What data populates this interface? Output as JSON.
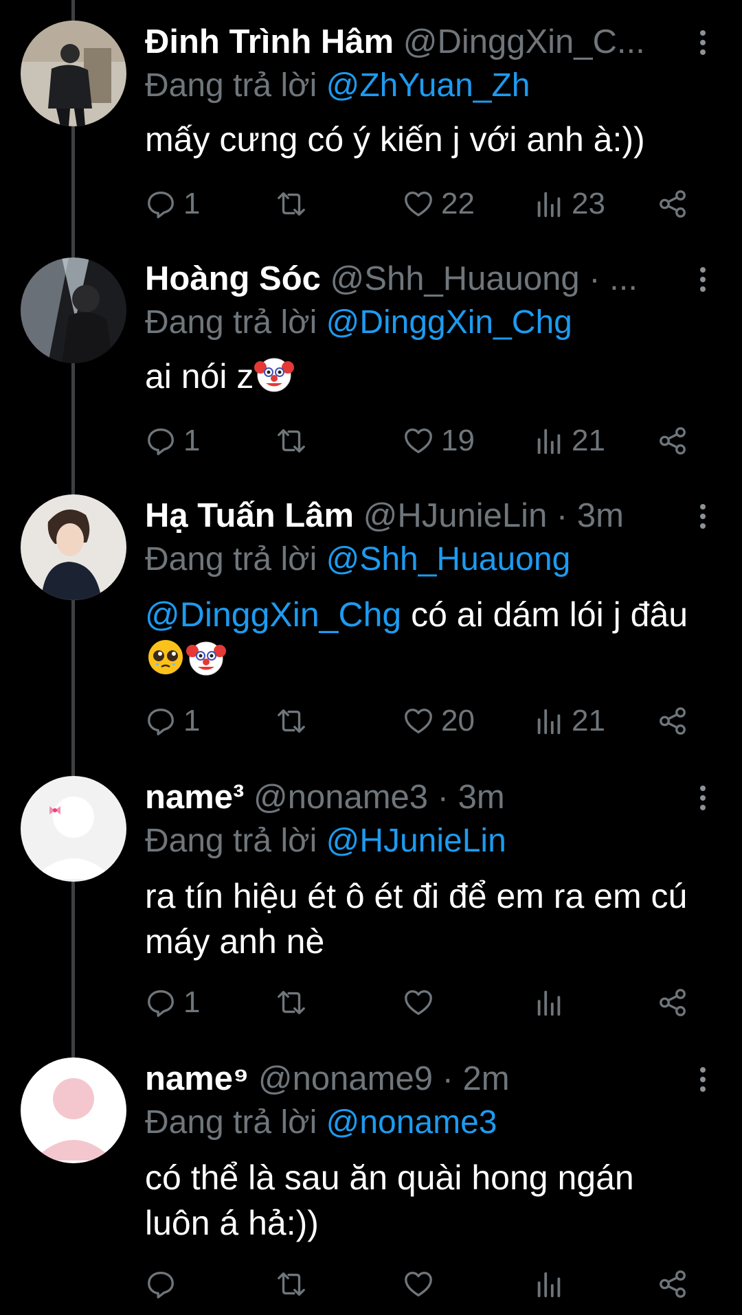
{
  "reply_prefix": "Đang trả lời",
  "icons": {
    "more": "more-vertical-icon",
    "reply": "comment-icon",
    "retweet": "retweet-icon",
    "like": "heart-icon",
    "views": "views-bar-icon",
    "share": "share-icon"
  },
  "colors": {
    "background": "#000000",
    "mention": "#1d9bf0",
    "muted": "#6f767b",
    "thread_line": "#3e4144"
  },
  "tweets": [
    {
      "display_name": "Đinh Trình Hâm",
      "handle_meta": "@DinggXin_C...",
      "reply_to": "@ZhYuan_Zh",
      "body_lead_mention": "",
      "body": "mấy cưng có ý kiến j với anh à:))",
      "emojis": [],
      "replies": "1",
      "retweets": "",
      "likes": "22",
      "views": "23"
    },
    {
      "display_name": "Hoàng Sóc",
      "handle_meta": "@Shh_Huauong · ...",
      "reply_to": "@DinggXin_Chg",
      "body_lead_mention": "",
      "body": "ai nói z",
      "emojis": [
        "clown-face"
      ],
      "replies": "1",
      "retweets": "",
      "likes": "19",
      "views": "21"
    },
    {
      "display_name": "Hạ Tuấn Lâm",
      "handle_meta": "@HJunieLin · 3m",
      "reply_to": "@Shh_Huauong",
      "body_lead_mention": "@DinggXin_Chg",
      "body": " có ai dám lói j đâu",
      "emojis": [
        "pleading-face",
        "clown-face"
      ],
      "replies": "1",
      "retweets": "",
      "likes": "20",
      "views": "21"
    },
    {
      "display_name": "name³",
      "handle_meta": "@noname3 · 3m",
      "reply_to": "@HJunieLin",
      "body_lead_mention": "",
      "body": "ra tín hiệu ét ô ét đi để em ra em cú máy anh nè",
      "emojis": [],
      "replies": "1",
      "retweets": "",
      "likes": "",
      "views": ""
    },
    {
      "display_name": "name⁹",
      "handle_meta": "@noname9 · 2m",
      "reply_to": "@noname3",
      "body_lead_mention": "",
      "body": "có thể là sau ăn quài hong ngán luôn á hả:))",
      "emojis": [],
      "replies": "",
      "retweets": "",
      "likes": "",
      "views": ""
    }
  ]
}
